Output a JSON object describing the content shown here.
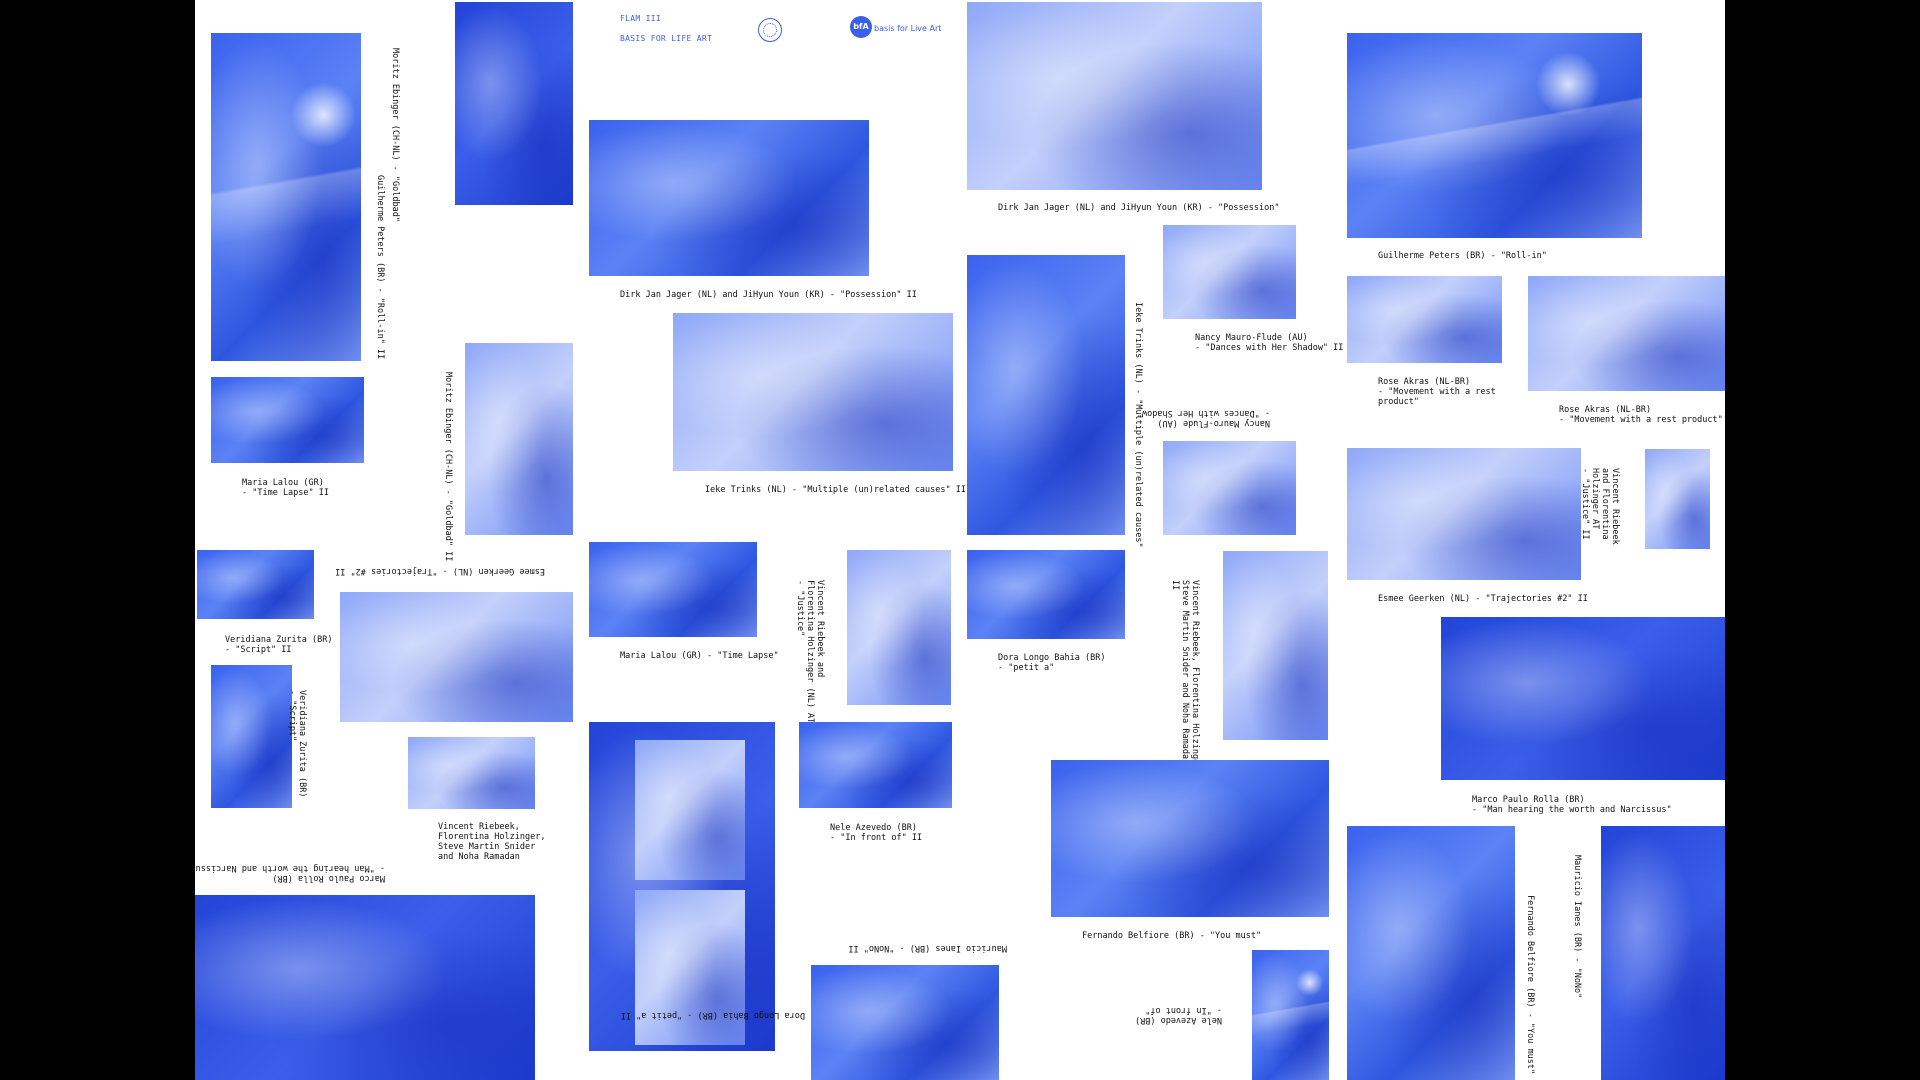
{
  "header": {
    "line1": "FLAM III",
    "line2": "BASIS FOR LIFE ART",
    "logo_mark": "bfA",
    "logo_text": "basis for Live Art"
  },
  "captions": {
    "c01": "Moritz Ebinger (CH-NL) - \"Goldbad\"",
    "c02": "Guilherme Peters (BR) - \"Roll-in\" II",
    "c03": "Dirk Jan Jager (NL) and JiHyun Youn (KR) - \"Possession\" II",
    "c04": "Dirk Jan Jager (NL) and JiHyun Youn (KR) - \"Possession\"",
    "c05": "Guilherme Peters (BR) - \"Roll-in\"",
    "c06": "Nancy Mauro-Flude (AU)\n- \"Dances with Her Shadow\" II",
    "c07": "Rose Akras (NL-BR)\n- \"Movement with a rest\nproduct\"",
    "c08": "Rose Akras (NL-BR)\n- \"Movement with a rest product\" II",
    "c09": "Maria Lalou (GR)\n- \"Time Lapse\" II",
    "c10": "Moritz Ebinger (CH-NL) - \"Goldbad\" II",
    "c11": "Ieke Trinks (NL) - \"Multiple (un)related causes\" II",
    "c12": "Ieke Trinks (NL) - \"Multiple (un)related causes\"",
    "c13": "Nancy Mauro-Flude (AU)\n- \"Dances with Her Shadow\"",
    "c14": "Vincent Riebeek\nand Florentina\nHolzinger AT\n- \"Justice\" II",
    "c15": "Esmee Geerken (NL) - \"Trajectories #2\" II",
    "c16": "Esmee Geerken (NL) - \"Trajectories #2\" II",
    "c17": "Veridiana Zurita (BR)\n- \"Script\" II",
    "c18": "Maria Lalou (GR) - \"Time Lapse\"",
    "c19": "Vincent Riebeek and\nFlorentina Holzinger (NL) AT\n- \"Justice\"",
    "c20": "Dora Longo Bahia (BR)\n- \"petit a\"",
    "c21": "Vincent Riebeek, Florentina Holzinger,\nSteve Martin Snider and Noha Ramadan\nII",
    "c22": "Veridiana Zurita (BR)\n- \"Script\"",
    "c23": "Vincent Riebeek,\nFlorentina Holzinger,\nSteve Martin Snider\nand Noha Ramadan",
    "c24": "Nele Azevedo (BR)\n- \"In front of\" II",
    "c25": "Marco Paulo Rolla (BR)\n- \"Man hearing the worth and Narcissus\"",
    "c26": "Marco Paulo Rolla (BR)\n- \"Man hearing the worth and Narcissus\" II",
    "c27": "Dora Longo Bahia (BR) - \"petit a\" II",
    "c28": "Mauricio Ianes (BR) - \"NoNo\" II",
    "c29": "Fernando Belfiore (BR) - \"You must\"",
    "c30": "Nele Azevedo (BR)\n- \"In front of\"",
    "c31": "Fernando Belfiore (BR) - \"You must\" II",
    "c32": "Mauricio Ianes (BR) - \"NoNo\""
  }
}
